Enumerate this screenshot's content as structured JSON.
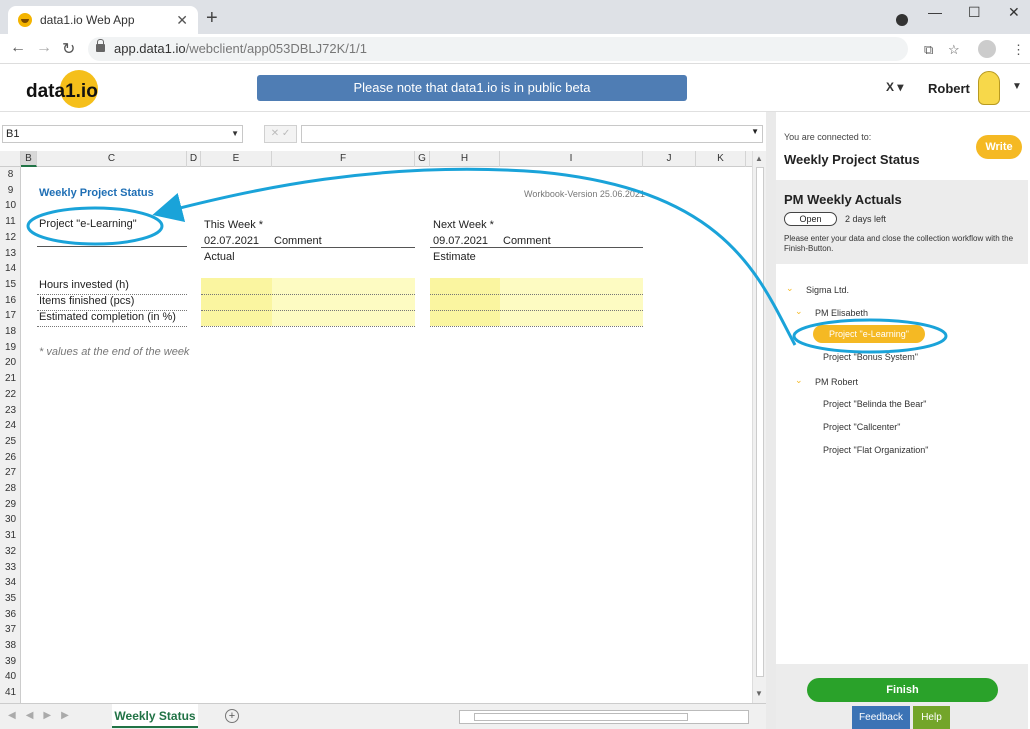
{
  "browser": {
    "tab_title": "data1.io Web App",
    "url_domain": "app.data1.io",
    "url_path": "/webclient/app053DBLJ72K/1/1"
  },
  "app": {
    "logo": "data1.io",
    "beta_notice": "Please note that data1.io is in public beta",
    "user_name": "Robert"
  },
  "formula": {
    "name_box": "B1",
    "content": ""
  },
  "sheet": {
    "columns": [
      "B",
      "C",
      "D",
      "E",
      "F",
      "G",
      "H",
      "I",
      "J",
      "K"
    ],
    "rows": [
      "8",
      "9",
      "10",
      "11",
      "12",
      "13",
      "14",
      "15",
      "16",
      "17",
      "18",
      "19",
      "20",
      "21",
      "22",
      "23",
      "24",
      "25",
      "26",
      "27",
      "28",
      "29",
      "30",
      "31",
      "32",
      "33",
      "34",
      "35",
      "36",
      "37",
      "38",
      "39",
      "40",
      "41"
    ],
    "title": "Weekly Project Status",
    "version": "Workbook-Version 25.06.2021",
    "project": "Project \"e-Learning\"",
    "this_week": "This Week *",
    "this_date": "02.07.2021",
    "comment1": "Comment",
    "actual": "Actual",
    "next_week": "Next Week *",
    "next_date": "09.07.2021",
    "comment2": "Comment",
    "estimate": "Estimate",
    "hours": "Hours invested (h)",
    "items": "Items finished (pcs)",
    "completion": "Estimated completion (in %)",
    "footnote": "* values at the end of the week",
    "tab_name": "Weekly Status"
  },
  "panel": {
    "connected_to": "You are connected to:",
    "workbook": "Weekly Project Status",
    "write_label": "Write",
    "collection_title": "PM Weekly Actuals",
    "status": "Open",
    "days_left": "2 days left",
    "note": "Please enter your data and close the collection workflow with the Finish-Button.",
    "tree": {
      "company": "Sigma Ltd.",
      "pm1": "PM Elisabeth",
      "p1": "Project \"e-Learning\"",
      "p2": "Project \"Bonus System\"",
      "pm2": "PM Robert",
      "p3": "Project \"Belinda the Bear\"",
      "p4": "Project \"Callcenter\"",
      "p5": "Project \"Flat Organization\""
    },
    "finish_label": "Finish",
    "feedback_label": "Feedback",
    "help_label": "Help"
  },
  "colors": {
    "accent_yellow": "#f5b923",
    "beta_blue": "#4f7db4",
    "finish_green": "#2aa22a",
    "sheet_title_blue": "#1f6fb5",
    "highlight_cyan": "#1aa3d9"
  },
  "icons": [
    "favicon-icon",
    "close-tab-icon",
    "new-tab-icon",
    "back-icon",
    "forward-icon",
    "reload-icon",
    "lock-icon",
    "translate-icon",
    "star-icon",
    "profile-icon",
    "menu-icon",
    "excel-icon",
    "avatar-icon",
    "chevron-down-icon",
    "add-sheet-icon"
  ]
}
